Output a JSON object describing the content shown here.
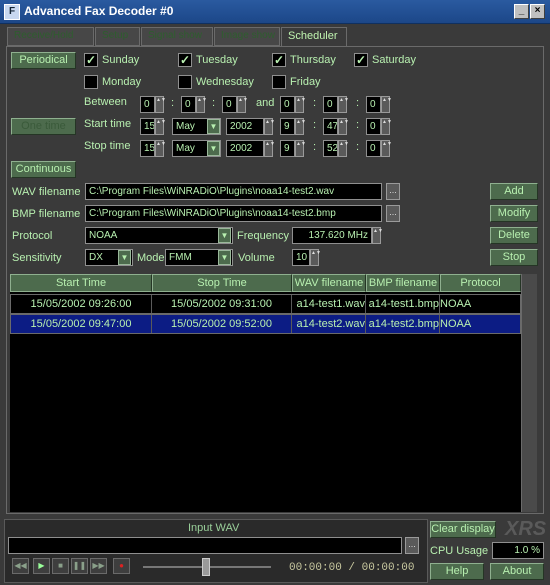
{
  "app": {
    "title": "Advanced Fax Decoder #0"
  },
  "tabs": [
    {
      "label": "Receive/Hold",
      "active": false
    },
    {
      "label": "Setup",
      "active": false
    },
    {
      "label": "Signal show",
      "active": false
    },
    {
      "label": "Image show",
      "active": false
    },
    {
      "label": "Scheduler",
      "active": true
    }
  ],
  "scheduler": {
    "periodical_label": "Periodical",
    "one_time_label": "One time",
    "continuous_label": "Continuous",
    "days": [
      {
        "label": "Sunday",
        "checked": true
      },
      {
        "label": "Tuesday",
        "checked": true
      },
      {
        "label": "Thursday",
        "checked": true
      },
      {
        "label": "Saturday",
        "checked": true
      },
      {
        "label": "Monday",
        "checked": false
      },
      {
        "label": "Wednesday",
        "checked": false
      },
      {
        "label": "Friday",
        "checked": false
      }
    ],
    "between_label": "Between",
    "and_label": "and",
    "between_start": [
      "0",
      "0",
      "0"
    ],
    "between_end": [
      "0",
      "0",
      "0"
    ],
    "start_time_label": "Start time",
    "stop_time_label": "Stop time",
    "start": {
      "day": "15",
      "month": "May",
      "year": "2002",
      "h": "9",
      "m": "47",
      "s": "0"
    },
    "stop": {
      "day": "15",
      "month": "May",
      "year": "2002",
      "h": "9",
      "m": "52",
      "s": "0"
    },
    "wav_label": "WAV filename",
    "wav_value": "C:\\Program Files\\WiNRADiO\\Plugins\\noaa14-test2.wav",
    "bmp_label": "BMP filename",
    "bmp_value": "C:\\Program Files\\WiNRADiO\\Plugins\\noaa14-test2.bmp",
    "protocol_label": "Protocol",
    "protocol_value": "NOAA",
    "frequency_label": "Frequency",
    "frequency_value": "137.620 MHz",
    "sensitivity_label": "Sensitivity",
    "sensitivity_value": "DX",
    "mode_label": "Mode",
    "mode_value": "FMM",
    "volume_label": "Volume",
    "volume_value": "10",
    "buttons": {
      "add": "Add",
      "modify": "Modify",
      "delete": "Delete",
      "stop": "Stop"
    },
    "table": {
      "headers": [
        "Start Time",
        "Stop Time",
        "WAV filename",
        "BMP filename",
        "Protocol"
      ],
      "rows": [
        {
          "start": "15/05/2002  09:26:00",
          "stop": "15/05/2002  09:31:00",
          "wav": "a14-test1.wav",
          "bmp": "a14-test1.bmp",
          "protocol": "NOAA",
          "selected": false
        },
        {
          "start": "15/05/2002  09:47:00",
          "stop": "15/05/2002  09:52:00",
          "wav": "a14-test2.wav",
          "bmp": "a14-test2.bmp",
          "protocol": "NOAA",
          "selected": true
        }
      ]
    }
  },
  "footer": {
    "input_wav_label": "Input WAV",
    "time_display": "00:00:00  /  00:00:00",
    "clear_display": "Clear display",
    "cpu_usage_label": "CPU Usage",
    "cpu_usage_value": "1.0 %",
    "help": "Help",
    "about": "About",
    "logo": "XRS"
  }
}
